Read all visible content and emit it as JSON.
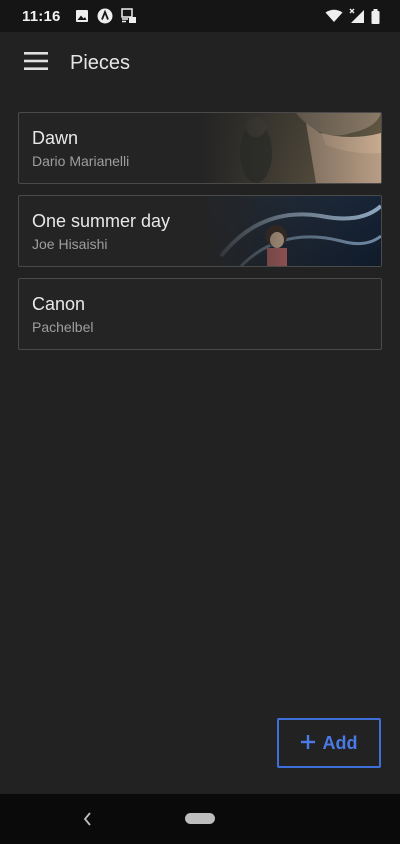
{
  "status_bar": {
    "time": "11:16",
    "icons_left": [
      "image-icon",
      "app-logo-icon",
      "cast-icon"
    ],
    "icons_right": [
      "wifi-icon",
      "signal-icon",
      "battery-icon"
    ]
  },
  "app_bar": {
    "menu_icon": "hamburger-menu-icon",
    "title": "Pieces"
  },
  "pieces": [
    {
      "title": "Dawn",
      "composer": "Dario Marianelli",
      "has_image": true
    },
    {
      "title": "One summer day",
      "composer": "Joe Hisaishi",
      "has_image": true
    },
    {
      "title": "Canon",
      "composer": "Pachelbel",
      "has_image": false
    }
  ],
  "add_button": {
    "icon": "plus-icon",
    "label": "Add",
    "color": "#3f6fd8"
  },
  "nav_bar": {
    "back_icon": "back-chevron-icon",
    "home_icon": "home-pill-icon"
  },
  "colors": {
    "background": "#222222",
    "card_border": "#4a4a4a",
    "accent": "#3f6fd8"
  }
}
